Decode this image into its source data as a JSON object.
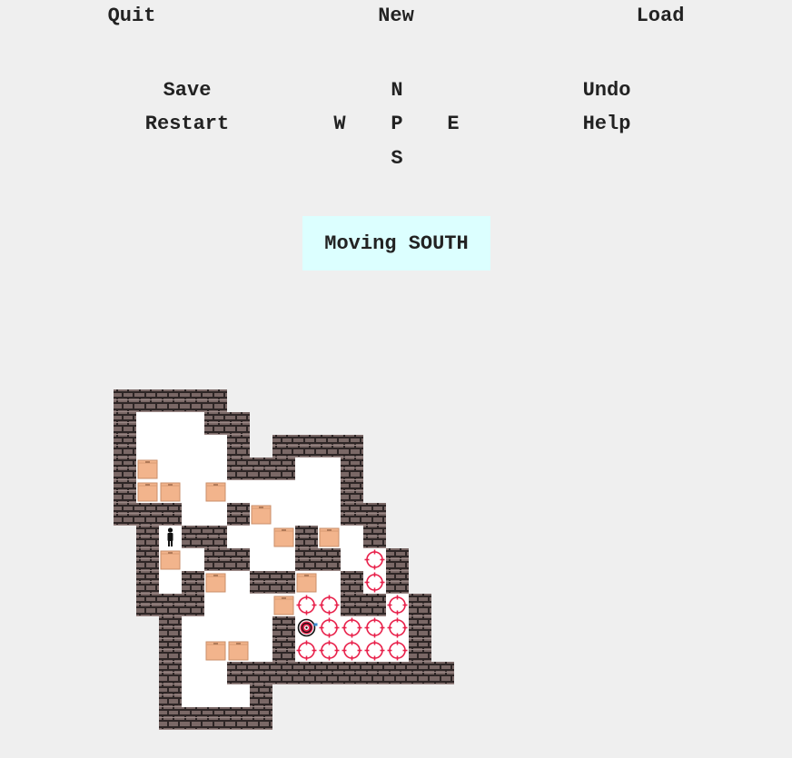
{
  "menu": {
    "quit": "Quit",
    "new": "New",
    "load": "Load",
    "save": "Save",
    "restart": "Restart",
    "undo": "Undo",
    "help": "Help"
  },
  "dpad": {
    "north": "N",
    "west": "W",
    "player": "P",
    "east": "E",
    "south": "S"
  },
  "status": {
    "message": "Moving SOUTH"
  },
  "board": {
    "legend": {
      "#": "wall",
      " ": "floor",
      "$": "box",
      ".": "goal",
      "@": "player",
      "+": "player-on-goal",
      "-": "outside"
    },
    "map": [
      "#####-------",
      "#   ##------",
      "#    #-####-",
      "#$   ###  #-",
      "#$$ $     #-",
      "###  #$   ##",
      "-#@##  $#$ #",
      "-#$ ##  ## .#",
      "-# #$ ##$ #.#",
      "-###   $..##.#",
      "--#    #+....#",
      "--# $$ #.....#",
      "--#  ##########",
      "--#   #--------",
      "--#####--------"
    ],
    "colors": {
      "background": "#efefef",
      "wall": "#7a6866",
      "mortar": "#2e2626",
      "box": "#f2b48c",
      "goal": "#e8204a",
      "player": "#111111"
    }
  }
}
